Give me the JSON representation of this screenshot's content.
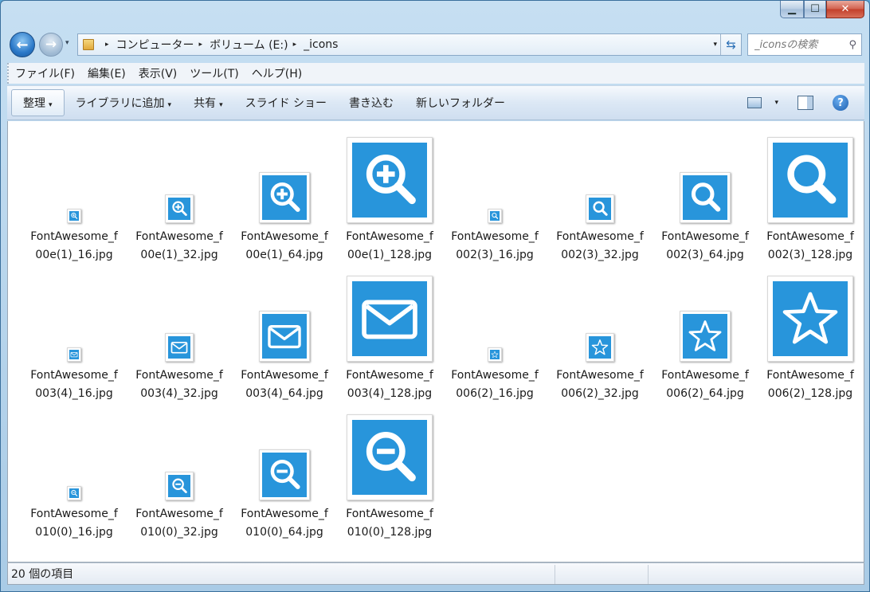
{
  "window": {
    "caption": {
      "minimize": "▁",
      "maximize": "☐",
      "close": "✕"
    }
  },
  "nav": {
    "back_glyph": "←",
    "forward_glyph": "→",
    "history_glyph": "▾",
    "breadcrumb": [
      "コンピューター",
      "ボリューム (E:)",
      "_icons"
    ],
    "crumb_arrow": "▸",
    "dropdown_glyph": "▾",
    "refresh_glyph": "⇆"
  },
  "search": {
    "placeholder": "_iconsの検索",
    "icon": "search-icon",
    "glyph": "⚲"
  },
  "menu": [
    "ファイル(F)",
    "編集(E)",
    "表示(V)",
    "ツール(T)",
    "ヘルプ(H)"
  ],
  "commands": {
    "organize": "整理",
    "add_to_library": "ライブラリに追加",
    "share": "共有",
    "slideshow": "スライド ショー",
    "burn": "書き込む",
    "new_folder": "新しいフォルダー",
    "caret": "▾",
    "help_glyph": "?"
  },
  "accent": "#2895db",
  "files": [
    {
      "line1": "FontAwesome_f",
      "line2": "00e(1)_16.jpg",
      "icon": "zoom-in-icon",
      "size": 16
    },
    {
      "line1": "FontAwesome_f",
      "line2": "00e(1)_32.jpg",
      "icon": "zoom-in-icon",
      "size": 32
    },
    {
      "line1": "FontAwesome_f",
      "line2": "00e(1)_64.jpg",
      "icon": "zoom-in-icon",
      "size": 64
    },
    {
      "line1": "FontAwesome_f",
      "line2": "00e(1)_128.jpg",
      "icon": "zoom-in-icon",
      "size": 128
    },
    {
      "line1": "FontAwesome_f",
      "line2": "002(3)_16.jpg",
      "icon": "search-icon",
      "size": 16
    },
    {
      "line1": "FontAwesome_f",
      "line2": "002(3)_32.jpg",
      "icon": "search-icon",
      "size": 32
    },
    {
      "line1": "FontAwesome_f",
      "line2": "002(3)_64.jpg",
      "icon": "search-icon",
      "size": 64
    },
    {
      "line1": "FontAwesome_f",
      "line2": "002(3)_128.jpg",
      "icon": "search-icon",
      "size": 128
    },
    {
      "line1": "FontAwesome_f",
      "line2": "003(4)_16.jpg",
      "icon": "envelope-icon",
      "size": 16
    },
    {
      "line1": "FontAwesome_f",
      "line2": "003(4)_32.jpg",
      "icon": "envelope-icon",
      "size": 32
    },
    {
      "line1": "FontAwesome_f",
      "line2": "003(4)_64.jpg",
      "icon": "envelope-icon",
      "size": 64
    },
    {
      "line1": "FontAwesome_f",
      "line2": "003(4)_128.jpg",
      "icon": "envelope-icon",
      "size": 128
    },
    {
      "line1": "FontAwesome_f",
      "line2": "006(2)_16.jpg",
      "icon": "star-icon",
      "size": 16
    },
    {
      "line1": "FontAwesome_f",
      "line2": "006(2)_32.jpg",
      "icon": "star-icon",
      "size": 32
    },
    {
      "line1": "FontAwesome_f",
      "line2": "006(2)_64.jpg",
      "icon": "star-icon",
      "size": 64
    },
    {
      "line1": "FontAwesome_f",
      "line2": "006(2)_128.jpg",
      "icon": "star-icon",
      "size": 128
    },
    {
      "line1": "FontAwesome_f",
      "line2": "010(0)_16.jpg",
      "icon": "zoom-out-icon",
      "size": 16
    },
    {
      "line1": "FontAwesome_f",
      "line2": "010(0)_32.jpg",
      "icon": "zoom-out-icon",
      "size": 32
    },
    {
      "line1": "FontAwesome_f",
      "line2": "010(0)_64.jpg",
      "icon": "zoom-out-icon",
      "size": 64
    },
    {
      "line1": "FontAwesome_f",
      "line2": "010(0)_128.jpg",
      "icon": "zoom-out-icon",
      "size": 128
    }
  ],
  "status": {
    "item_count": "20 個の項目"
  }
}
